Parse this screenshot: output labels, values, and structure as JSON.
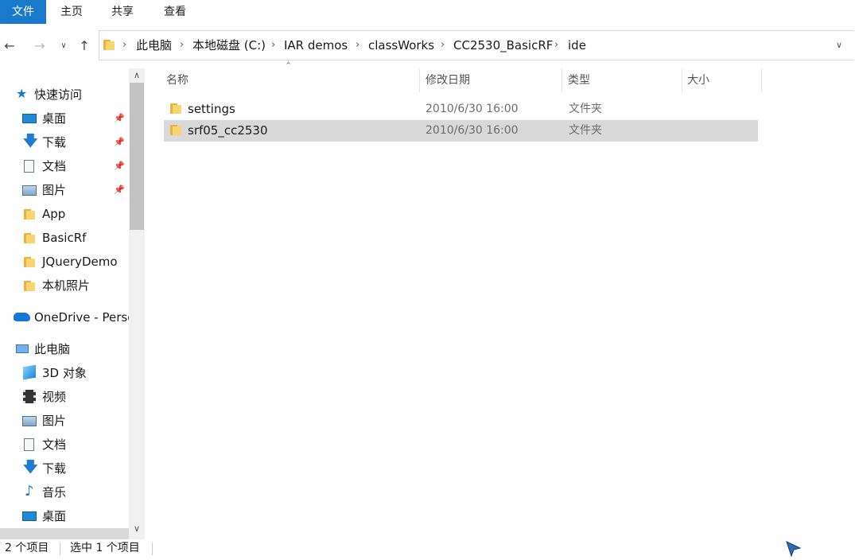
{
  "ribbon": {
    "tabs": [
      "文件",
      "主页",
      "共享",
      "查看"
    ]
  },
  "address": {
    "crumbs": [
      "此电脑",
      "本地磁盘 (C:)",
      "IAR demos",
      "classWorks",
      "CC2530_BasicRF",
      "ide"
    ]
  },
  "nav": {
    "quick_access": "快速访问",
    "quick_items": [
      {
        "label": "桌面",
        "icon": "desktop-icon",
        "pinned": true
      },
      {
        "label": "下载",
        "icon": "download-icon",
        "pinned": true
      },
      {
        "label": "文档",
        "icon": "document-icon",
        "pinned": true
      },
      {
        "label": "图片",
        "icon": "picture-icon",
        "pinned": true
      },
      {
        "label": "App",
        "icon": "folder-icon",
        "pinned": false
      },
      {
        "label": "BasicRf",
        "icon": "folder-icon",
        "pinned": false
      },
      {
        "label": "JQueryDemo",
        "icon": "folder-icon",
        "pinned": false
      },
      {
        "label": "本机照片",
        "icon": "folder-icon",
        "pinned": false
      }
    ],
    "onedrive": "OneDrive - Perso",
    "this_pc": "此电脑",
    "pc_items": [
      {
        "label": "3D 对象",
        "icon": "3d-objects-icon"
      },
      {
        "label": "视频",
        "icon": "video-icon"
      },
      {
        "label": "图片",
        "icon": "picture-icon"
      },
      {
        "label": "文档",
        "icon": "document-icon"
      },
      {
        "label": "下载",
        "icon": "download-icon"
      },
      {
        "label": "音乐",
        "icon": "music-icon"
      },
      {
        "label": "桌面",
        "icon": "desktop-icon"
      }
    ]
  },
  "columns": {
    "name": "名称",
    "modified": "修改日期",
    "type": "类型",
    "size": "大小"
  },
  "files": [
    {
      "name": "settings",
      "modified": "2010/6/30 16:00",
      "type": "文件夹",
      "selected": false
    },
    {
      "name": "srf05_cc2530",
      "modified": "2010/6/30 16:00",
      "type": "文件夹",
      "selected": true
    }
  ],
  "status": {
    "count": "2 个项目",
    "selected": "选中 1 个项目"
  },
  "colors": {
    "accent": "#1979ca",
    "selection": "#d9d9d9"
  }
}
